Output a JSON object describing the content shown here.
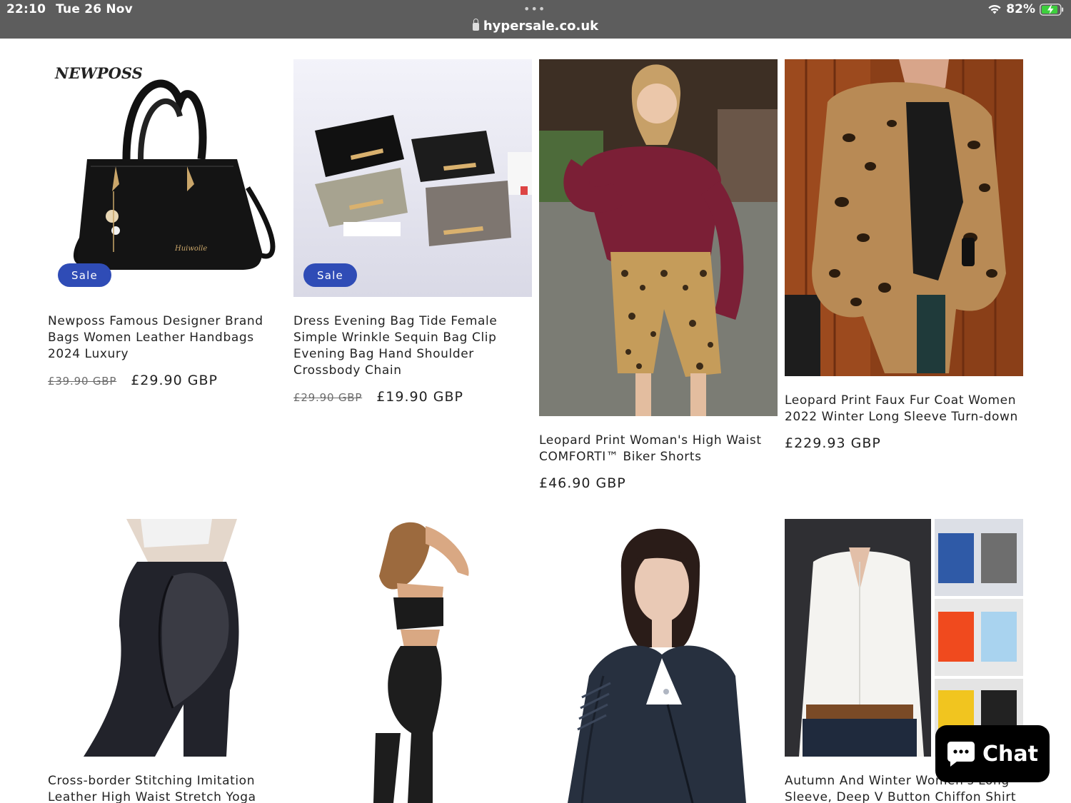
{
  "status_bar": {
    "time": "22:10",
    "date": "Tue 26 Nov",
    "battery": "82%",
    "menu_dots": "•••"
  },
  "address_bar": {
    "url": "hypersale.co.uk"
  },
  "products": [
    {
      "title": "Newposs Famous Designer Brand Bags Women Leather Handbags 2024 Luxury",
      "old_price": "£39.90 GBP",
      "price": "£29.90 GBP",
      "badge": "Sale",
      "brand_text": "NEWPOSS"
    },
    {
      "title": "Dress Evening Bag Tide Female Simple Wrinkle Sequin Bag Clip Evening Bag Hand Shoulder Crossbody Chain",
      "old_price": "£29.90 GBP",
      "price": "£19.90 GBP",
      "badge": "Sale"
    },
    {
      "title": "Leopard Print Woman's High Waist COMFORTI™ Biker Shorts",
      "price": "£46.90 GBP"
    },
    {
      "title": "Leopard Print Faux Fur Coat Women 2022 Winter Long Sleeve Turn-down",
      "price": "£229.93 GBP"
    },
    {
      "title": "Cross-border Stitching Imitation Leather High Waist Stretch Yoga Pants"
    },
    {
      "title": ""
    },
    {
      "title": ""
    },
    {
      "title": "Autumn And Winter Women's Long Sleeve, Deep V Button Chiffon Shirt"
    }
  ],
  "chat": {
    "label": "Chat"
  },
  "colors": {
    "badge": "#2f4cb6",
    "topbar": "#5d5d5d",
    "battery": "#3ecf3e"
  }
}
